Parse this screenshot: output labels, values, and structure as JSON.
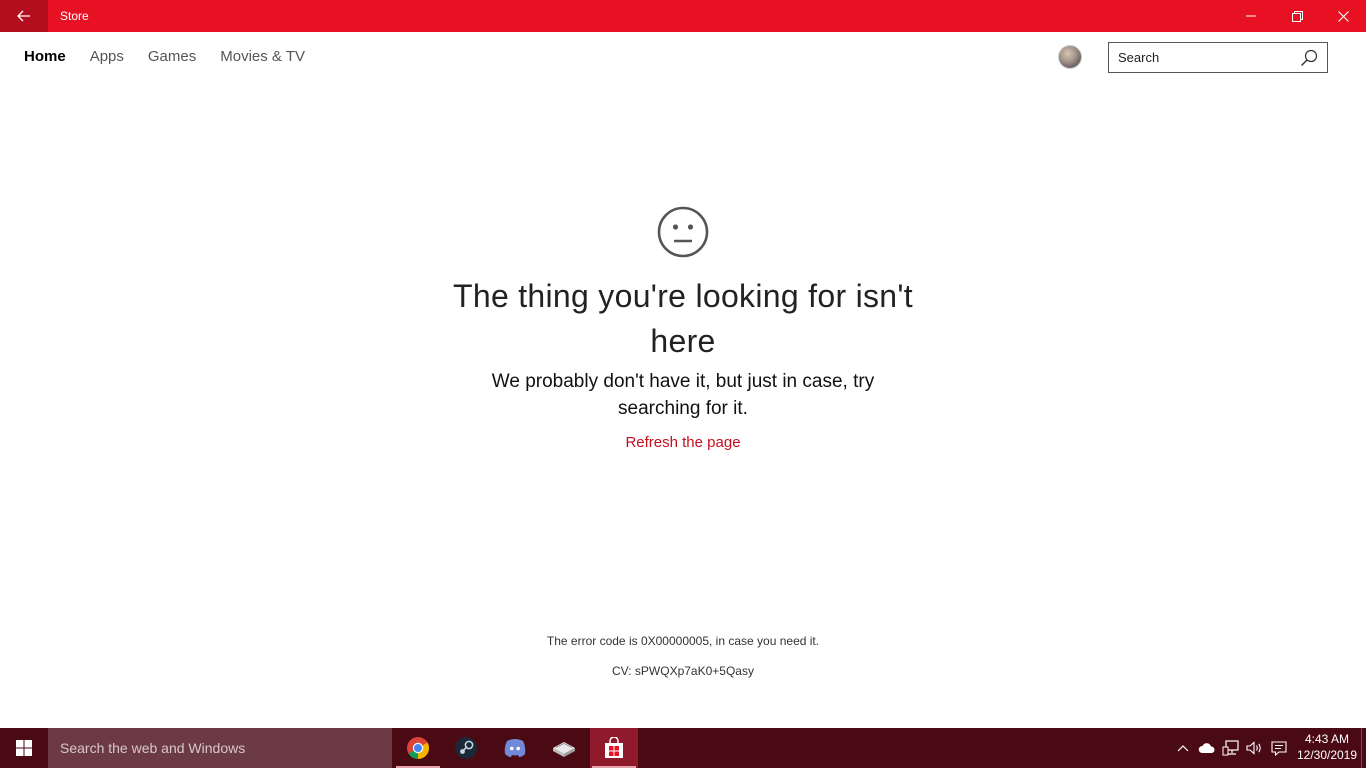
{
  "window": {
    "title": "Store",
    "accent_color": "#e81123"
  },
  "nav": {
    "items": [
      {
        "label": "Home",
        "active": true
      },
      {
        "label": "Apps"
      },
      {
        "label": "Games"
      },
      {
        "label": "Movies & TV"
      }
    ]
  },
  "search": {
    "placeholder": "Search",
    "icon": "search-icon"
  },
  "error_page": {
    "icon": "neutral-face-icon",
    "headline": "The thing you're looking for isn't here",
    "subline": "We probably don't have it, but just in case, try searching for it.",
    "refresh_label": "Refresh the page",
    "error_code_text": "The error code is 0X00000005, in case you need it.",
    "cv_text": "CV: sPWQXp7aK0+5Qasy",
    "link_color": "#c50f1f"
  },
  "taskbar": {
    "search_placeholder": "Search the web and Windows",
    "apps": [
      "chrome-icon",
      "steam-icon",
      "discord-icon",
      "books-icon",
      "store-icon"
    ],
    "time": "4:43 AM",
    "date": "12/30/2019",
    "background_color": "#4a0a14"
  }
}
